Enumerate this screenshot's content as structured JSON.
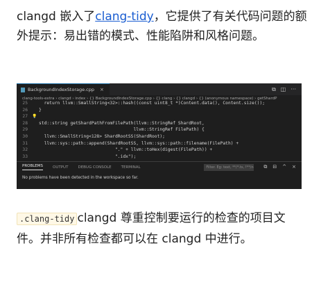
{
  "intro": {
    "prefix": "clangd 嵌入了",
    "link": "clang-tidy",
    "suffix": "，它提供了有关代码问题的额外提示：易出错的模式、性能陷阱和风格问题。"
  },
  "screenshot": {
    "tab_label": "BackgroundIndexStorage.cpp",
    "tab_close": "×",
    "window_actions": [
      "⧉",
      "◫",
      "···"
    ],
    "breadcrumb": "clang-tools-extra › clangd › index › {} BackgroundIndexStorage.cpp › {} clang › {} clangd › {} (anonymous namespace) › getShardP",
    "code_lines": [
      {
        "ln": "25",
        "gutter": "",
        "text": "  return llvm::SmallString<32>::hash((const uint8_t *)Content.data(), Content.size());"
      },
      {
        "ln": "26",
        "gutter": "",
        "text": "}"
      },
      {
        "ln": "27",
        "gutter": "💡",
        "text": ""
      },
      {
        "ln": "28",
        "gutter": "",
        "text": "std::string getShardPathFromFilePath(llvm::StringRef ShardRoot,"
      },
      {
        "ln": "29",
        "gutter": "",
        "text": "                                    llvm::StringRef FilePath) {"
      },
      {
        "ln": "30",
        "gutter": "",
        "text": "  llvm::SmallString<128> ShardRootSS(ShardRoot);"
      },
      {
        "ln": "31",
        "gutter": "",
        "text": "  llvm::sys::path::append(ShardRootSS, llvm::sys::path::filename(FilePath) +"
      },
      {
        "ln": "32",
        "gutter": "",
        "text": "                             \".\" + llvm::toHex(digest(FilePath)) +"
      },
      {
        "ln": "33",
        "gutter": "",
        "text": "                             \".idx\");"
      }
    ],
    "panel": {
      "tabs": [
        "PROBLEMS",
        "OUTPUT",
        "DEBUG CONSOLE",
        "TERMINAL"
      ],
      "active_tab": "PROBLEMS",
      "filter_placeholder": "Filter. Eg: text, **/*.ts, !**/node_...",
      "actions": [
        "⧉",
        "⊟",
        "^",
        "×"
      ],
      "message": "No problems have been detected in the workspace so far."
    }
  },
  "outro": {
    "code": ".clang-tidy",
    "text": "clangd 尊重控制要运行的检查的项目文件。并非所有检查都可以在 clangd 中进行。"
  },
  "colors": {
    "link": "#1a5dd1",
    "editor_bg": "#1e1e1e",
    "inline_code_bg": "#fff8e6"
  }
}
